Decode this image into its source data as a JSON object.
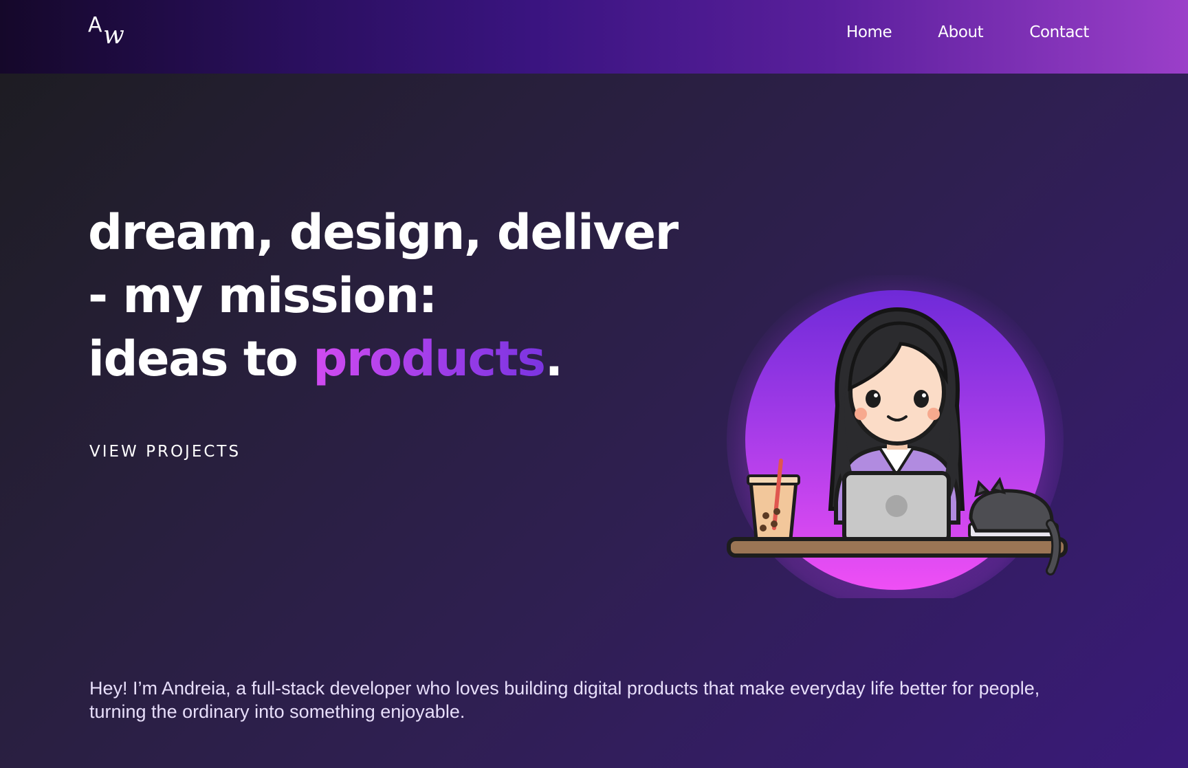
{
  "header": {
    "logo_letter_a": "A",
    "logo_letter_w": "w",
    "nav": [
      {
        "label": "Home"
      },
      {
        "label": "About"
      },
      {
        "label": "Contact"
      }
    ]
  },
  "hero": {
    "line1": "dream, design, deliver",
    "line2": "- my mission:",
    "line3_prefix": "ideas to ",
    "line3_accent": "products",
    "line3_suffix": ".",
    "cta_label": "VIEW PROJECTS"
  },
  "intro": {
    "text": "Hey! I’m Andreia, a full-stack developer who loves building digital products that make everyday life better for people, turning the ordinary into something enjoyable."
  },
  "colors": {
    "accent_start": "#d14bf0",
    "accent_end": "#7b34e0",
    "header_start": "#15082a",
    "header_end": "#9b3fc9"
  },
  "illustration": {
    "icon": "developer-avatar-illustration"
  }
}
